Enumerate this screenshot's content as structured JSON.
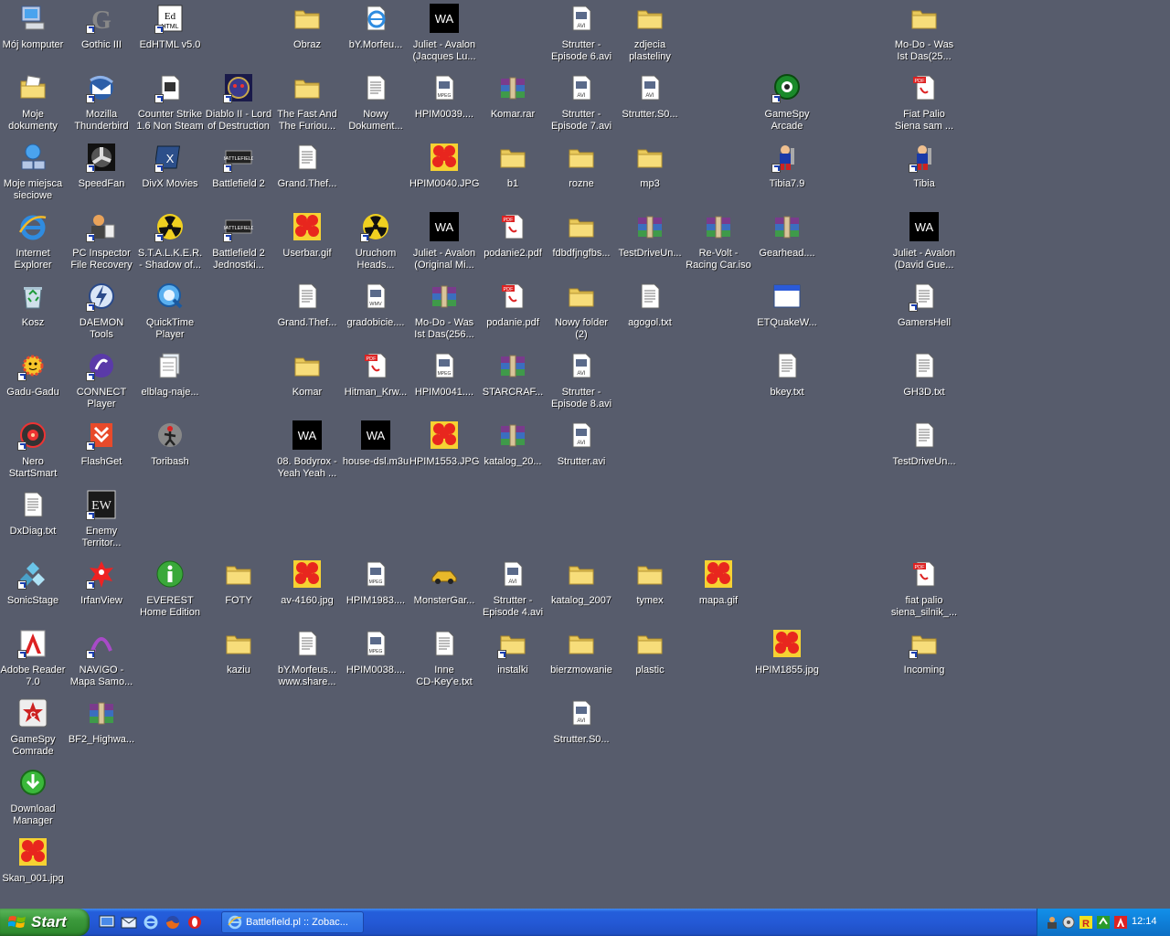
{
  "desktop": {
    "icons": [
      {
        "label": "Mój komputer",
        "icon": "my-computer-icon",
        "shortcut": false
      },
      {
        "label": "Gothic III",
        "icon": "gothic-iii-icon",
        "shortcut": true
      },
      {
        "label": "EdHTML v5.0",
        "icon": "edhtml-icon",
        "shortcut": true
      },
      {
        "label": "Obraz",
        "icon": "folder-icon",
        "shortcut": false
      },
      {
        "label": "bY.Morfeu...",
        "icon": "internet-shortcut-icon",
        "shortcut": false
      },
      {
        "label": "Juliet - Avalon\n(Jacques Lu...",
        "icon": "winamp-media-icon",
        "shortcut": false
      },
      {
        "label": "Strutter -\nEpisode 6.avi",
        "icon": "avi-file-icon",
        "shortcut": false
      },
      {
        "label": "zdjecia\nplasteliny",
        "icon": "folder-icon",
        "shortcut": false
      },
      {
        "label": "Mo-Do - Was\nIst Das(25...",
        "icon": "folder-icon",
        "shortcut": false
      },
      {
        "label": "Moje\ndokumenty",
        "icon": "my-documents-icon",
        "shortcut": false
      },
      {
        "label": "Mozilla\nThunderbird",
        "icon": "thunderbird-icon",
        "shortcut": true
      },
      {
        "label": "Counter Strike\n1.6 Non Steam",
        "icon": "counter-strike-icon",
        "shortcut": true
      },
      {
        "label": "Diablo II - Lord\nof Destruction",
        "icon": "diablo-ii-icon",
        "shortcut": true
      },
      {
        "label": "The Fast And\nThe Furiou...",
        "icon": "folder-icon",
        "shortcut": false
      },
      {
        "label": "Nowy\nDokument...",
        "icon": "text-document-icon",
        "shortcut": false
      },
      {
        "label": "HPIM0039....",
        "icon": "mpeg-file-icon",
        "shortcut": false
      },
      {
        "label": "Komar.rar",
        "icon": "rar-archive-icon",
        "shortcut": false
      },
      {
        "label": "Strutter -\nEpisode 7.avi",
        "icon": "avi-file-icon",
        "shortcut": false
      },
      {
        "label": "Strutter.S0...",
        "icon": "avi-file-icon",
        "shortcut": false
      },
      {
        "label": "GameSpy\nArcade",
        "icon": "gamespy-arcade-icon",
        "shortcut": true
      },
      {
        "label": "Fiat Palio\nSiena sam ...",
        "icon": "pdf-file-icon",
        "shortcut": false
      },
      {
        "label": "Moje miejsca\nsieciowe",
        "icon": "network-places-icon",
        "shortcut": false
      },
      {
        "label": "SpeedFan",
        "icon": "speedfan-icon",
        "shortcut": true
      },
      {
        "label": "DivX Movies",
        "icon": "divx-icon",
        "shortcut": true
      },
      {
        "label": "Battlefield 2",
        "icon": "battlefield-2-icon",
        "shortcut": true
      },
      {
        "label": "Grand.Thef...",
        "icon": "text-document-icon",
        "shortcut": false
      },
      {
        "label": "HPIM0040.JPG",
        "icon": "jpg-image-icon",
        "shortcut": false
      },
      {
        "label": "b1",
        "icon": "folder-icon",
        "shortcut": false
      },
      {
        "label": "rozne",
        "icon": "folder-icon",
        "shortcut": false
      },
      {
        "label": "mp3",
        "icon": "folder-icon",
        "shortcut": false
      },
      {
        "label": "Tibia7.9",
        "icon": "tibia-icon",
        "shortcut": true
      },
      {
        "label": "Tibia",
        "icon": "tibia-icon",
        "shortcut": true
      },
      {
        "label": "Internet\nExplorer",
        "icon": "internet-explorer-icon",
        "shortcut": false
      },
      {
        "label": "PC Inspector\nFile Recovery",
        "icon": "pc-inspector-icon",
        "shortcut": true
      },
      {
        "label": "S.T.A.L.K.E.R.\n- Shadow of...",
        "icon": "stalker-radiation-icon",
        "shortcut": true
      },
      {
        "label": "Battlefield 2\nJednostki...",
        "icon": "battlefield-2-icon",
        "shortcut": true
      },
      {
        "label": "Userbar.gif",
        "icon": "gif-image-icon",
        "shortcut": false
      },
      {
        "label": "Uruchom\nHeads...",
        "icon": "stalker-radiation-icon",
        "shortcut": true
      },
      {
        "label": "Juliet - Avalon\n(Original Mi...",
        "icon": "winamp-media-icon",
        "shortcut": false
      },
      {
        "label": "podanie2.pdf",
        "icon": "pdf-file-icon",
        "shortcut": false
      },
      {
        "label": "fdbdfjngfbs...",
        "icon": "folder-icon",
        "shortcut": false
      },
      {
        "label": "TestDriveUn...",
        "icon": "rar-archive-icon",
        "shortcut": false
      },
      {
        "label": "Re-Volt -\nRacing Car.iso",
        "icon": "rar-archive-icon",
        "shortcut": false
      },
      {
        "label": "Gearhead....",
        "icon": "rar-archive-icon",
        "shortcut": false
      },
      {
        "label": "Juliet - Avalon\n(David Gue...",
        "icon": "winamp-media-icon",
        "shortcut": false
      },
      {
        "label": "Kosz",
        "icon": "recycle-bin-icon",
        "shortcut": false
      },
      {
        "label": "DAEMON Tools",
        "icon": "daemon-tools-icon",
        "shortcut": true
      },
      {
        "label": "QuickTime\nPlayer",
        "icon": "quicktime-icon",
        "shortcut": false
      },
      {
        "label": "Grand.Thef...",
        "icon": "text-document-icon",
        "shortcut": false
      },
      {
        "label": "gradobicie....",
        "icon": "wmv-file-icon",
        "shortcut": false
      },
      {
        "label": "Mo-Do - Was\nIst Das(256...",
        "icon": "rar-archive-icon",
        "shortcut": false
      },
      {
        "label": "podanie.pdf",
        "icon": "pdf-file-icon",
        "shortcut": false
      },
      {
        "label": "Nowy folder\n(2)",
        "icon": "folder-icon",
        "shortcut": false
      },
      {
        "label": "agogol.txt",
        "icon": "text-document-icon",
        "shortcut": false
      },
      {
        "label": "ETQuakeW...",
        "icon": "application-window-icon",
        "shortcut": false
      },
      {
        "label": "GamersHell",
        "icon": "text-document-icon",
        "shortcut": true
      },
      {
        "label": "Gadu-Gadu",
        "icon": "gadu-gadu-icon",
        "shortcut": true
      },
      {
        "label": "CONNECT\nPlayer",
        "icon": "connect-player-icon",
        "shortcut": true
      },
      {
        "label": "elblag-naje...",
        "icon": "file-stack-icon",
        "shortcut": false
      },
      {
        "label": "Komar",
        "icon": "folder-icon",
        "shortcut": false
      },
      {
        "label": "Hitman_Krw...",
        "icon": "pdf-file-icon",
        "shortcut": false
      },
      {
        "label": "HPIM0041....",
        "icon": "mpeg-file-icon",
        "shortcut": false
      },
      {
        "label": "STARCRAF...",
        "icon": "rar-archive-icon",
        "shortcut": false
      },
      {
        "label": "Strutter -\nEpisode 8.avi",
        "icon": "avi-file-icon",
        "shortcut": false
      },
      {
        "label": "bkey.txt",
        "icon": "text-document-icon",
        "shortcut": false
      },
      {
        "label": "GH3D.txt",
        "icon": "text-document-icon",
        "shortcut": false
      },
      {
        "label": "Nero\nStartSmart",
        "icon": "nero-icon",
        "shortcut": true
      },
      {
        "label": "FlashGet",
        "icon": "flashget-icon",
        "shortcut": true
      },
      {
        "label": "Toribash",
        "icon": "toribash-icon",
        "shortcut": false
      },
      {
        "label": "08. Bodyrox -\nYeah Yeah ...",
        "icon": "winamp-media-icon",
        "shortcut": false
      },
      {
        "label": "house-dsl.m3u",
        "icon": "winamp-media-icon",
        "shortcut": false
      },
      {
        "label": "HPIM1553.JPG",
        "icon": "jpg-image-icon",
        "shortcut": false
      },
      {
        "label": "katalog_20...",
        "icon": "rar-archive-icon",
        "shortcut": false
      },
      {
        "label": "Strutter.avi",
        "icon": "avi-file-icon",
        "shortcut": false
      },
      {
        "label": "TestDriveUn...",
        "icon": "text-document-icon",
        "shortcut": false
      },
      {
        "label": "DxDiag.txt",
        "icon": "text-document-icon",
        "shortcut": false
      },
      {
        "label": "Enemy\nTerritor...",
        "icon": "enemy-territory-icon",
        "shortcut": true
      },
      {
        "label": "SonicStage",
        "icon": "sonicstage-icon",
        "shortcut": true
      },
      {
        "label": "IrfanView",
        "icon": "irfanview-icon",
        "shortcut": true
      },
      {
        "label": "EVEREST\nHome Edition",
        "icon": "everest-info-icon",
        "shortcut": false
      },
      {
        "label": "FOTY",
        "icon": "folder-icon",
        "shortcut": false
      },
      {
        "label": "av-4160.jpg",
        "icon": "jpg-image-icon",
        "shortcut": false
      },
      {
        "label": "HPIM1983....",
        "icon": "mpeg-file-icon",
        "shortcut": false
      },
      {
        "label": "MonsterGar...",
        "icon": "monster-garage-icon",
        "shortcut": false
      },
      {
        "label": "Strutter -\nEpisode 4.avi",
        "icon": "avi-file-icon",
        "shortcut": false
      },
      {
        "label": "katalog_2007",
        "icon": "folder-icon",
        "shortcut": false
      },
      {
        "label": "tymex",
        "icon": "folder-icon",
        "shortcut": false
      },
      {
        "label": "mapa.gif",
        "icon": "gif-image-icon",
        "shortcut": false
      },
      {
        "label": "fiat palio\nsiena_silnik_...",
        "icon": "pdf-file-icon",
        "shortcut": false
      },
      {
        "label": "Adobe Reader\n7.0",
        "icon": "adobe-reader-icon",
        "shortcut": true
      },
      {
        "label": "NAVIGO -\nMapa Samo...",
        "icon": "navigo-icon",
        "shortcut": true
      },
      {
        "label": "kaziu",
        "icon": "folder-icon",
        "shortcut": false
      },
      {
        "label": "bY.Morfeus...\nwww.share...",
        "icon": "text-document-icon",
        "shortcut": false
      },
      {
        "label": "HPIM0038....",
        "icon": "mpeg-file-icon",
        "shortcut": false
      },
      {
        "label": "Inne\nCD-Key'e.txt",
        "icon": "text-document-icon",
        "shortcut": false
      },
      {
        "label": "instalki",
        "icon": "folder-icon",
        "shortcut": true
      },
      {
        "label": "bierzmowanie",
        "icon": "folder-icon",
        "shortcut": false
      },
      {
        "label": "plastic",
        "icon": "folder-icon",
        "shortcut": false
      },
      {
        "label": "HPIM1855.jpg",
        "icon": "jpg-image-icon",
        "shortcut": false
      },
      {
        "label": "Incoming",
        "icon": "folder-icon",
        "shortcut": true
      },
      {
        "label": "GameSpy\nComrade",
        "icon": "gamespy-comrade-icon",
        "shortcut": false
      },
      {
        "label": "BF2_Highwa...",
        "icon": "rar-archive-icon",
        "shortcut": false
      },
      {
        "label": "Strutter.S0...",
        "icon": "avi-file-icon",
        "shortcut": false
      },
      {
        "label": "Download\nManager",
        "icon": "download-manager-icon",
        "shortcut": false
      },
      {
        "label": "Skan_001.jpg",
        "icon": "jpg-image-icon",
        "shortcut": false
      }
    ]
  },
  "taskbar": {
    "start_label": "Start",
    "quick_launch": [
      {
        "icon": "show-desktop-icon"
      },
      {
        "icon": "outlook-express-icon"
      },
      {
        "icon": "internet-explorer-icon"
      },
      {
        "icon": "firefox-icon"
      },
      {
        "icon": "opera-icon"
      }
    ],
    "task_button_label": "Battlefield.pl :: Zobac...",
    "tray_icons": [
      {
        "icon": "pc-inspector-tray-icon"
      },
      {
        "icon": "volume-tray-icon"
      },
      {
        "icon": "avast-tray-icon"
      },
      {
        "icon": "flashget-tray-icon"
      },
      {
        "icon": "adobe-tray-icon"
      }
    ],
    "clock": "12:14"
  }
}
